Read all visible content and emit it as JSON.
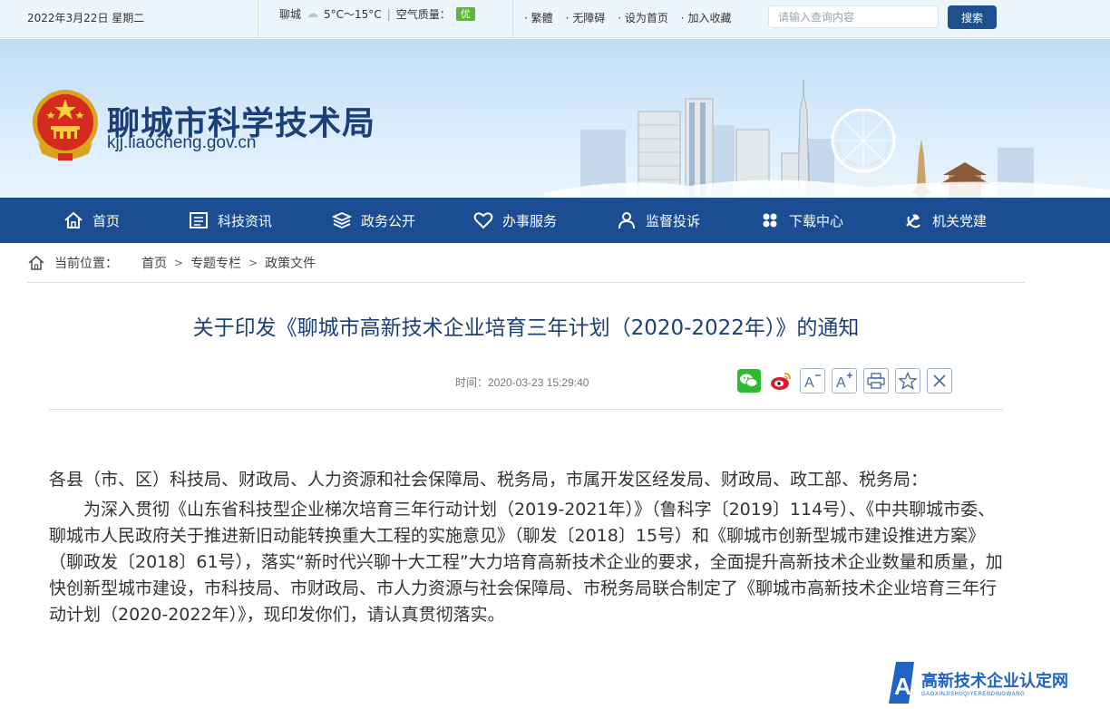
{
  "topbar": {
    "date": "2022年3月22日 星期二",
    "city": "聊城",
    "temperature": "5°C～15°C",
    "air_quality_label": "空气质量：",
    "air_quality_value": "优",
    "links": [
      "· 繁體",
      "· 无障碍",
      "· 设为首页",
      "· 加入收藏"
    ],
    "search_placeholder": "请输入查询内容",
    "search_button": "搜索"
  },
  "header": {
    "site_title": "聊城市科学技术局",
    "site_domain": "kjj.liaocheng.gov.cn"
  },
  "nav": {
    "items": [
      {
        "label": "首页",
        "icon": "home-icon"
      },
      {
        "label": "科技资讯",
        "icon": "news-icon"
      },
      {
        "label": "政务公开",
        "icon": "layers-icon"
      },
      {
        "label": "办事服务",
        "icon": "heart-icon"
      },
      {
        "label": "监督投诉",
        "icon": "user-icon"
      },
      {
        "label": "下载中心",
        "icon": "clover-icon"
      },
      {
        "label": "机关党建",
        "icon": "party-icon"
      }
    ]
  },
  "breadcrumb": {
    "label": "当前位置：",
    "items": [
      "首页",
      "专题专栏",
      "政策文件"
    ],
    "separator": ">"
  },
  "article": {
    "title": "关于印发《聊城市高新技术企业培育三年计划（2020-2022年）》的通知",
    "time": "时间：2020-03-23 15:29:40",
    "tools": [
      "wechat-icon",
      "weibo-icon",
      "font-decrease-icon",
      "font-increase-icon",
      "print-icon",
      "favorite-icon",
      "close-icon"
    ],
    "salutation": "各县（市、区）科技局、财政局、人力资源和社会保障局、税务局，市属开发区经发局、财政局、政工部、税务局：",
    "paragraph": "为深入贯彻《山东省科技型企业梯次培育三年行动计划（2019-2021年）》（鲁科字〔2019〕114号）、《中共聊城市委、聊城市人民政府关于推进新旧动能转换重大工程的实施意见》（聊发〔2018〕15号）和《聊城市创新型城市建设推进方案》（聊政发〔2018〕61号），落实“新时代兴聊十大工程”大力培育高新技术企业的要求，全面提升高新技术企业数量和质量，加快创新型城市建设，市科技局、市财政局、市人力资源与社会保障局、市税务局联合制定了《聊城市高新技术企业培育三年行动计划（2020-2022年）》，现印发你们，请认真贯彻落实。"
  },
  "watermark": {
    "cn": "高新技术企业认定网",
    "en": "GAOXINJISHUQIYERENDINGWANG"
  },
  "colors": {
    "nav_bg": "#1a4d92",
    "title_blue": "#1b3f78",
    "aq_green": "#5fb43d",
    "watermark_blue": "#1f63c6"
  }
}
